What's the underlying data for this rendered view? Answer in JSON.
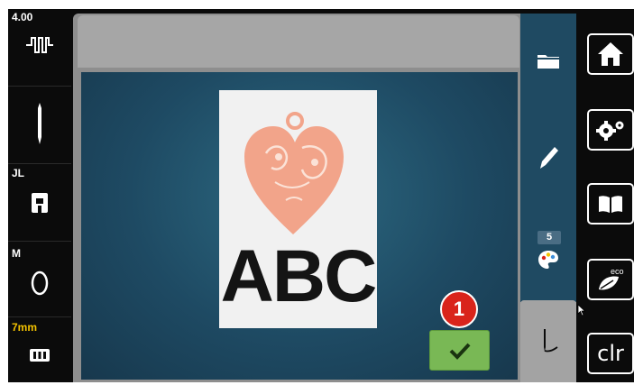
{
  "left_panel": {
    "stitch_width_label": "4.00",
    "stitch_icon": "stitch-pattern-icon",
    "needle_icon": "needle-icon",
    "presser_foot_label": "JL",
    "presser_foot_icon": "presser-foot-icon",
    "hoop_label": "M",
    "hoop_icon": "hoop-icon",
    "stabilizer_label": "7mm",
    "stabilizer_icon": "feed-dog-icon"
  },
  "preview": {
    "design_text": "ABC",
    "heart_color": "#f2a48a"
  },
  "tools": {
    "badge_count": "5"
  },
  "confirm": {
    "step_number": "1"
  },
  "system": {
    "clr_label": "clr"
  },
  "colors": {
    "accent_green": "#79b855",
    "step_red": "#d9241b",
    "screen_blue": "#1f4a62"
  }
}
